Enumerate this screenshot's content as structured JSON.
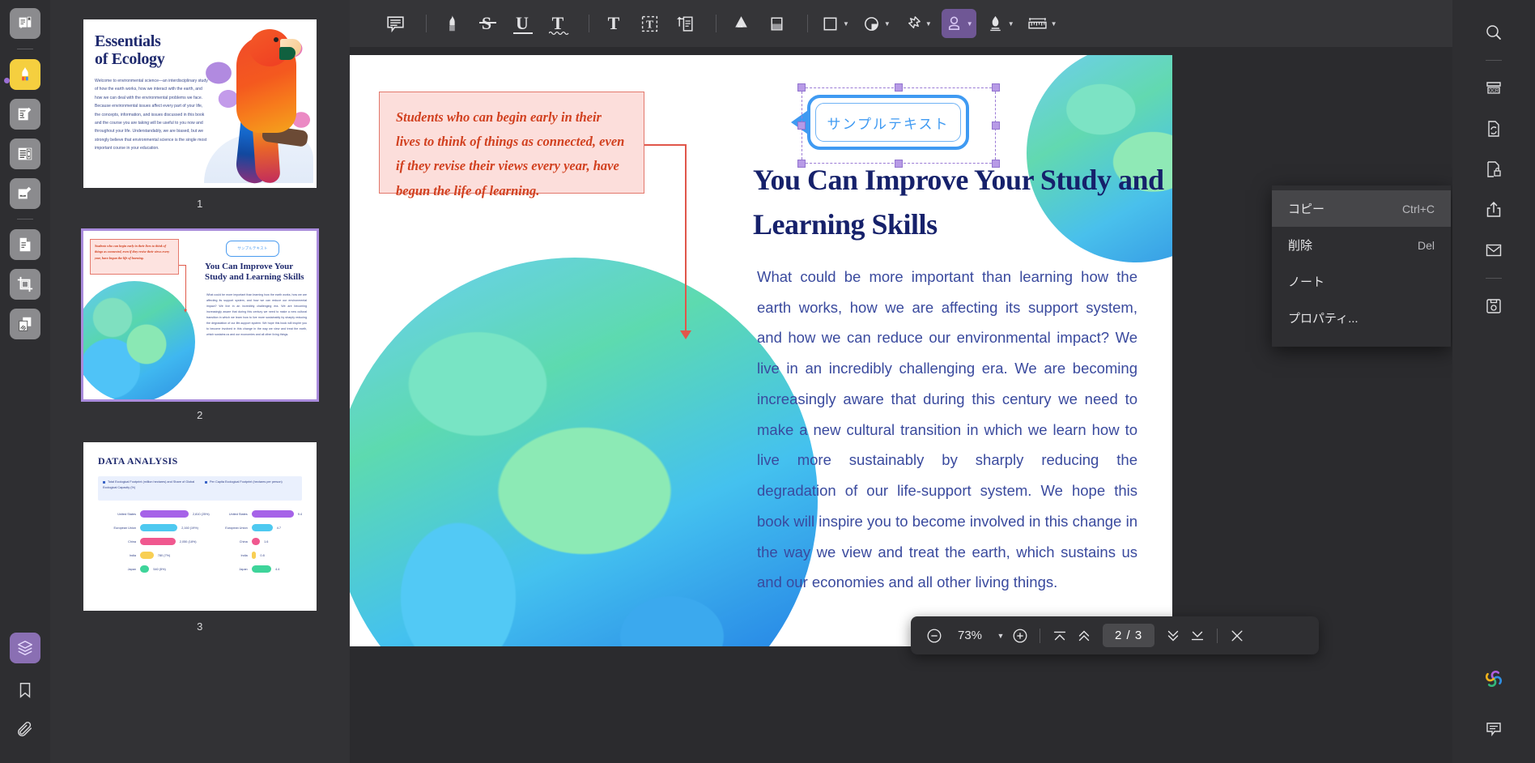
{
  "app": {
    "zoom_level": "73%",
    "page_indicator": "2 / 3"
  },
  "left_rail": {
    "items": [
      {
        "name": "read-mode",
        "icon": "book-reader-icon",
        "state": "default"
      },
      {
        "name": "highlighter-tool",
        "icon": "highlighter-icon",
        "state": "active"
      },
      {
        "name": "annotate-tool",
        "icon": "note-pen-icon",
        "state": "default"
      },
      {
        "name": "form-fields-tool",
        "icon": "form-list-icon",
        "state": "default"
      },
      {
        "name": "fill-sign-tool",
        "icon": "sign-pen-icon",
        "state": "default"
      },
      {
        "name": "page-organize",
        "icon": "page-edit-icon",
        "state": "default"
      },
      {
        "name": "crop-tool",
        "icon": "crop-icon",
        "state": "default"
      },
      {
        "name": "compare-tool",
        "icon": "compare-pages-icon",
        "state": "default"
      },
      {
        "name": "layers-panel",
        "icon": "layers-icon",
        "state": "selected"
      },
      {
        "name": "bookmarks-panel",
        "icon": "bookmark-icon",
        "state": "plain"
      },
      {
        "name": "attachments-panel",
        "icon": "paperclip-icon",
        "state": "plain"
      }
    ]
  },
  "toolbar": {
    "items": [
      {
        "name": "comment-tool",
        "icon": "comment-box-icon",
        "label": "",
        "caret": false,
        "active": false
      },
      {
        "name": "highlight-tool",
        "icon": "marker-icon",
        "label": "",
        "caret": false,
        "active": false
      },
      {
        "name": "strikethrough-tool",
        "icon": "strikethrough-icon",
        "label": "S",
        "caret": false,
        "active": false
      },
      {
        "name": "underline-tool",
        "icon": "underline-icon",
        "label": "U",
        "caret": false,
        "active": false
      },
      {
        "name": "squiggly-tool",
        "icon": "squiggly-underline-icon",
        "label": "T",
        "caret": false,
        "active": false
      },
      {
        "name": "text-tool",
        "icon": "text-icon",
        "label": "T",
        "caret": false,
        "active": false
      },
      {
        "name": "text-box-tool",
        "icon": "text-box-icon",
        "label": "",
        "caret": false,
        "active": false
      },
      {
        "name": "callout-tool",
        "icon": "callout-note-icon",
        "label": "",
        "caret": false,
        "active": false
      },
      {
        "name": "pencil-tool",
        "icon": "pencil-icon",
        "label": "",
        "caret": false,
        "active": false
      },
      {
        "name": "eraser-tool",
        "icon": "eraser-icon",
        "label": "",
        "caret": false,
        "active": false
      },
      {
        "name": "shape-tool",
        "icon": "rectangle-icon",
        "label": "",
        "caret": true,
        "active": false
      },
      {
        "name": "stamp-shape-tool",
        "icon": "circle-fold-icon",
        "label": "",
        "caret": true,
        "active": false
      },
      {
        "name": "pin-tool",
        "icon": "pushpin-icon",
        "label": "",
        "caret": true,
        "active": false
      },
      {
        "name": "stamp-tool",
        "icon": "stamp-person-icon",
        "label": "",
        "caret": true,
        "active": true
      },
      {
        "name": "signature-tool",
        "icon": "fountain-pen-icon",
        "label": "",
        "caret": true,
        "active": false
      },
      {
        "name": "measure-tool",
        "icon": "ruler-icon",
        "label": "",
        "caret": true,
        "active": false
      }
    ]
  },
  "right_rail": {
    "items": [
      {
        "name": "search-panel",
        "icon": "search-icon"
      },
      {
        "name": "ocr-tool",
        "icon": "ocr-icon"
      },
      {
        "name": "convert-tool",
        "icon": "file-convert-icon"
      },
      {
        "name": "protect-tool",
        "icon": "file-lock-icon"
      },
      {
        "name": "share-tool",
        "icon": "share-upload-icon"
      },
      {
        "name": "email-tool",
        "icon": "envelope-icon"
      },
      {
        "name": "save-tool",
        "icon": "floppy-save-icon"
      },
      {
        "name": "ai-assistant",
        "icon": "clover-ai-icon"
      },
      {
        "name": "comments-panel",
        "icon": "comment-box-icon"
      }
    ]
  },
  "context_menu": {
    "items": [
      {
        "label": "コピー",
        "shortcut": "Ctrl+C",
        "highlighted": true
      },
      {
        "label": "削除",
        "shortcut": "Del",
        "highlighted": false
      },
      {
        "label": "ノート",
        "shortcut": "",
        "highlighted": false
      },
      {
        "label": "プロパティ...",
        "shortcut": "",
        "highlighted": false
      }
    ]
  },
  "bottom_bar": {
    "zoom_out_label": "−",
    "zoom_value": "73%",
    "zoom_dropdown_caret": "▾",
    "zoom_in_label": "+",
    "first_page_icon": "first-page-icon",
    "prev_page_icon": "prev-page-icon",
    "page_indicator": "2 / 3",
    "next_page_icon": "next-page-icon",
    "last_page_icon": "last-page-icon",
    "close_label": "✕"
  },
  "thumbnails": [
    {
      "number": "1",
      "selected": false,
      "title": "Essentials\nof Ecology",
      "body": "Welcome to environmental science—an interdisciplinary study of how the earth works, how we interact with the earth, and how we can deal with the environmental problems we face. Because environmental issues affect every part of your life, the concepts, information, and issues discussed in this book and the course you are taking will be useful to you now and throughout your life. Understandably, we are biased, but we strongly believe that environmental science is the single most important course in your education."
    },
    {
      "number": "2",
      "selected": true,
      "quote": "Students who can begin early in their lives to think of things as connected, even if they revise their views every year, have begun the life of learning.",
      "bubble": "サンプルテキスト",
      "title": "You Can Improve Your Study and Learning Skills",
      "body": "What could be more important than learning how the earth works, how we are affecting its support system, and how we can reduce our environmental impact? We live in an incredibly challenging era. We are becoming increasingly aware that during this century we need to make a new cultural transition in which we learn how to live more sustainably by sharply reducing the degradation of our life-support system. We hope this book will inspire you to become involved in this change in the way we view and treat the earth, which sustains us and our economies and all other living things."
    },
    {
      "number": "3",
      "selected": false,
      "title": "DATA ANALYSIS",
      "legend_left": "Total Ecological Footprint (million hectares) and Share of Global Ecological Capacity (%)",
      "legend_right": "Per Capita Ecological Footprint (hectares per person)",
      "left_rows": [
        {
          "label": "United States",
          "value": "2,810 (25%)",
          "bar": 100,
          "color": "#a663e8"
        },
        {
          "label": "European Union",
          "value": "2,160 (19%)",
          "bar": 77,
          "color": "#4ec9f0"
        },
        {
          "label": "China",
          "value": "2,050 (18%)",
          "bar": 73,
          "color": "#f0588f"
        },
        {
          "label": "India",
          "value": "780 (7%)",
          "bar": 28,
          "color": "#f8cf54"
        },
        {
          "label": "Japan",
          "value": "540 (5%)",
          "bar": 19,
          "color": "#3ed49a"
        }
      ],
      "right_rows": [
        {
          "label": "United States",
          "value": "9.4",
          "bar": 100,
          "color": "#a663e8"
        },
        {
          "label": "European Union",
          "value": "4.7",
          "bar": 50,
          "color": "#4ec9f0"
        },
        {
          "label": "China",
          "value": "1.6",
          "bar": 20,
          "color": "#f0588f"
        },
        {
          "label": "India",
          "value": "0.8",
          "bar": 11,
          "color": "#f8cf54"
        },
        {
          "label": "Japan",
          "value": "4.4",
          "bar": 47,
          "color": "#3ed49a"
        }
      ]
    }
  ],
  "document": {
    "quote": "Students who can begin early in their lives to think of things as connected, even if they revise their views every year, have begun the life of learning.",
    "bubble_text": "サンプルテキスト",
    "title": "You Can Improve Your Study and Learning Skills",
    "body": "What could be more important than learning how the earth works, how we are affecting its support system, and how we can reduce our environmental impact? We live in an incredibly challenging era. We are becoming increasingly aware that during this century we need to make a new cultural transition in which we learn how to live more sustainably by sharply reducing the degradation of our life-support system. We hope this book will inspire you to become involved in this change in the way we view and treat the earth, which sustains us and our economies and all other living things."
  },
  "colors": {
    "accent_purple": "#8a6fb3",
    "highlight_yellow": "#f5cf3f",
    "panel_dark": "#2e2e31",
    "toolbar_dark": "#353538",
    "doc_navy": "#16216b",
    "quote_red": "#d1401f",
    "bubble_blue": "#3f9af2"
  }
}
